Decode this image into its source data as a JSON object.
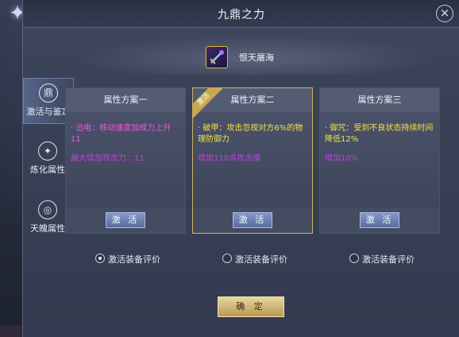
{
  "window": {
    "title": "九鼎之力"
  },
  "item": {
    "name": "恨天屠海"
  },
  "sidebar": {
    "items": [
      {
        "label": "激活与鉴定",
        "icon": "cauldron-icon",
        "active": true
      },
      {
        "label": "炼化属性",
        "icon": "sparkle-icon",
        "active": false
      },
      {
        "label": "天魄属性",
        "icon": "spirit-icon",
        "active": false
      }
    ]
  },
  "cards": [
    {
      "title": "属性方案一",
      "line1": "· 迅电：移动速度加成力上升 11",
      "line1_color": "#e85ad8",
      "line2": "最大增加攻击力：11",
      "line2_color": "#c040e0",
      "button": "激 活",
      "badge": "",
      "radio_label": "激活装备评价",
      "radio_checked": true
    },
    {
      "title": "属性方案二",
      "line1": "· 破甲：攻击忽视对方6%的物理防御力",
      "line1_color": "#f2e24a",
      "line2": "增加110点攻击值",
      "line2_color": "#c040e0",
      "button": "激 活",
      "badge": "激活",
      "radio_label": "激活装备评价",
      "radio_checked": false
    },
    {
      "title": "属性方案三",
      "line1": "· 御咒：受到不良状态持续时间降低12%",
      "line1_color": "#f2e24a",
      "line2": "增加10%",
      "line2_color": "#c040e0",
      "button": "激 活",
      "badge": "",
      "radio_label": "激活装备评价",
      "radio_checked": false
    }
  ],
  "confirm_label": "确 定",
  "colors": {
    "gold": "#d0b25d",
    "panel": "#3a4258"
  }
}
